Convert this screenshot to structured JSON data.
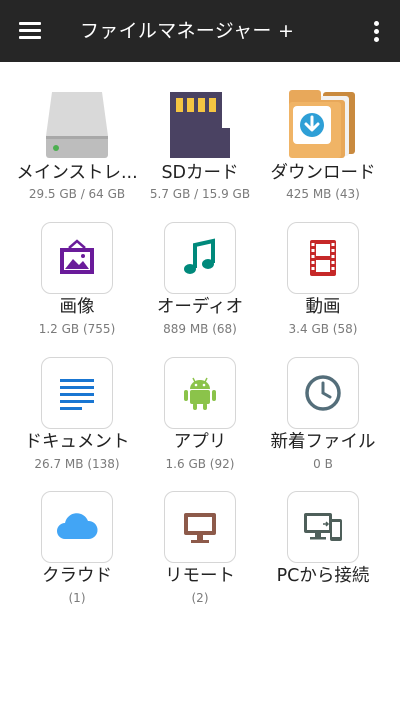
{
  "appbar": {
    "title": "ファイルマネージャー +",
    "menu_icon": "menu-icon",
    "more_icon": "more-vert-icon"
  },
  "colors": {
    "appbar": "#262626",
    "image": "#6a1b9a",
    "audio": "#00897b",
    "video": "#c62828",
    "docs": "#1976d2",
    "apps": "#8bc34a",
    "recent": "#546e7a",
    "cloud": "#42a5f5",
    "remote": "#8d5a4a"
  },
  "tiles": [
    {
      "label": "メインストレ...",
      "sub": "29.5 GB / 64 GB",
      "icon": "drive-icon"
    },
    {
      "label": "SDカード",
      "sub": "5.7 GB / 15.9 GB",
      "icon": "sd-card-icon"
    },
    {
      "label": "ダウンロード",
      "sub": "425 MB (43)",
      "icon": "download-folder-icon"
    },
    {
      "label": "画像",
      "sub": "1.2 GB (755)",
      "icon": "image-icon"
    },
    {
      "label": "オーディオ",
      "sub": "889 MB (68)",
      "icon": "music-note-icon"
    },
    {
      "label": "動画",
      "sub": "3.4 GB (58)",
      "icon": "film-icon"
    },
    {
      "label": "ドキュメント",
      "sub": "26.7 MB (138)",
      "icon": "document-icon"
    },
    {
      "label": "アプリ",
      "sub": "1.6 GB (92)",
      "icon": "android-icon"
    },
    {
      "label": "新着ファイル",
      "sub": "0 B",
      "icon": "clock-icon"
    },
    {
      "label": "クラウド",
      "sub": "(1)",
      "icon": "cloud-icon"
    },
    {
      "label": "リモート",
      "sub": "(2)",
      "icon": "monitor-icon"
    },
    {
      "label": "PCから接続",
      "sub": "",
      "icon": "pc-phone-icon"
    }
  ]
}
